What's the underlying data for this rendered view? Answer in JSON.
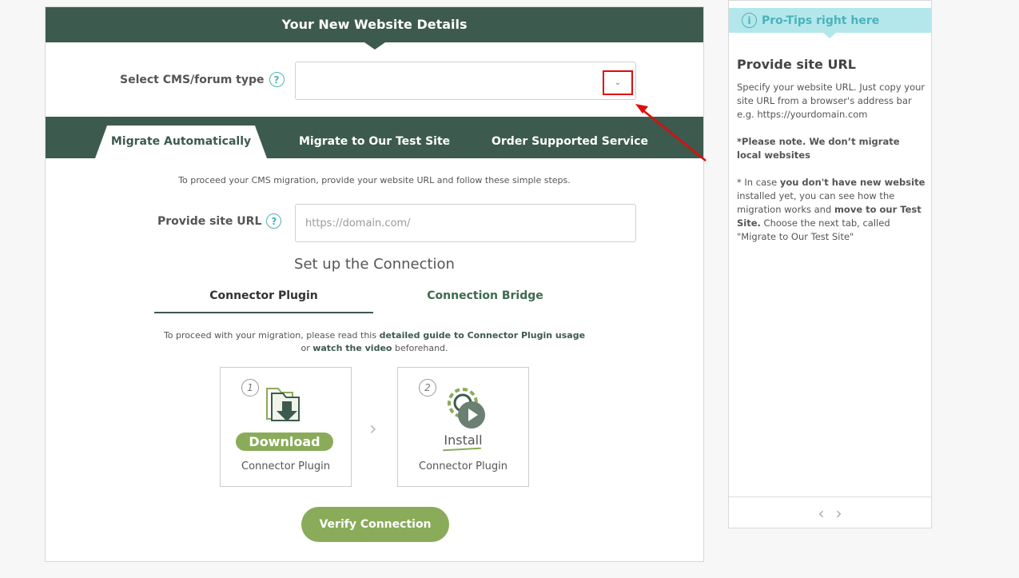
{
  "details": {
    "title": "Your New Website Details"
  },
  "cms": {
    "label": "Select CMS/forum type",
    "help": "?",
    "value": "",
    "chevron": "⌄"
  },
  "tabs": [
    {
      "label": "Migrate Automatically"
    },
    {
      "label": "Migrate to Our Test Site"
    },
    {
      "label": "Order Supported Service"
    }
  ],
  "intro": "To proceed your CMS migration, provide your website URL and follow these simple steps.",
  "url": {
    "label": "Provide site URL",
    "help": "?",
    "placeholder": "https://domain.com/"
  },
  "setup": {
    "title": "Set up the Connection"
  },
  "sub_tabs": [
    {
      "label": "Connector Plugin"
    },
    {
      "label": "Connection Bridge"
    }
  ],
  "guide": {
    "pre": "To proceed with your migration, please read this ",
    "link1": "detailed guide to Connector Plugin usage",
    "mid": "or ",
    "link2": "watch the video",
    "post": " beforehand."
  },
  "steps": [
    {
      "number": "1",
      "button": "Download",
      "caption": "Connector Plugin"
    },
    {
      "number": "2",
      "button": "Install",
      "caption": "Connector Plugin"
    }
  ],
  "step_arrow": "›",
  "verify": {
    "label": "Verify Connection"
  },
  "tips": {
    "header": "Pro-Tips right here",
    "info": "i",
    "title": "Provide site URL",
    "p1": "Specify your website URL. Just copy your site URL from a browser's address bar e.g. https://yourdomain.com",
    "p2": "*Please note. We don’t migrate local websites",
    "p3a": "* In case ",
    "p3b": "you don't have new website",
    "p3c": " installed yet, you can see how the migration works and ",
    "p3d": "move to our Test Site.",
    "p3e": " Choose the next tab, called \"Migrate to Our Test Site\"",
    "prev": "‹",
    "next": "›"
  },
  "colors": {
    "brand": "#3d5a4e",
    "accent_green": "#8aab59",
    "tips_teal": "#4ab3b9",
    "highlight_red": "#e20a0a"
  },
  "icons": [
    "help-icon",
    "chevron-down-icon",
    "download-folder-icon",
    "install-gear-icon",
    "play-icon",
    "info-icon",
    "chevron-left-icon",
    "chevron-right-icon"
  ]
}
